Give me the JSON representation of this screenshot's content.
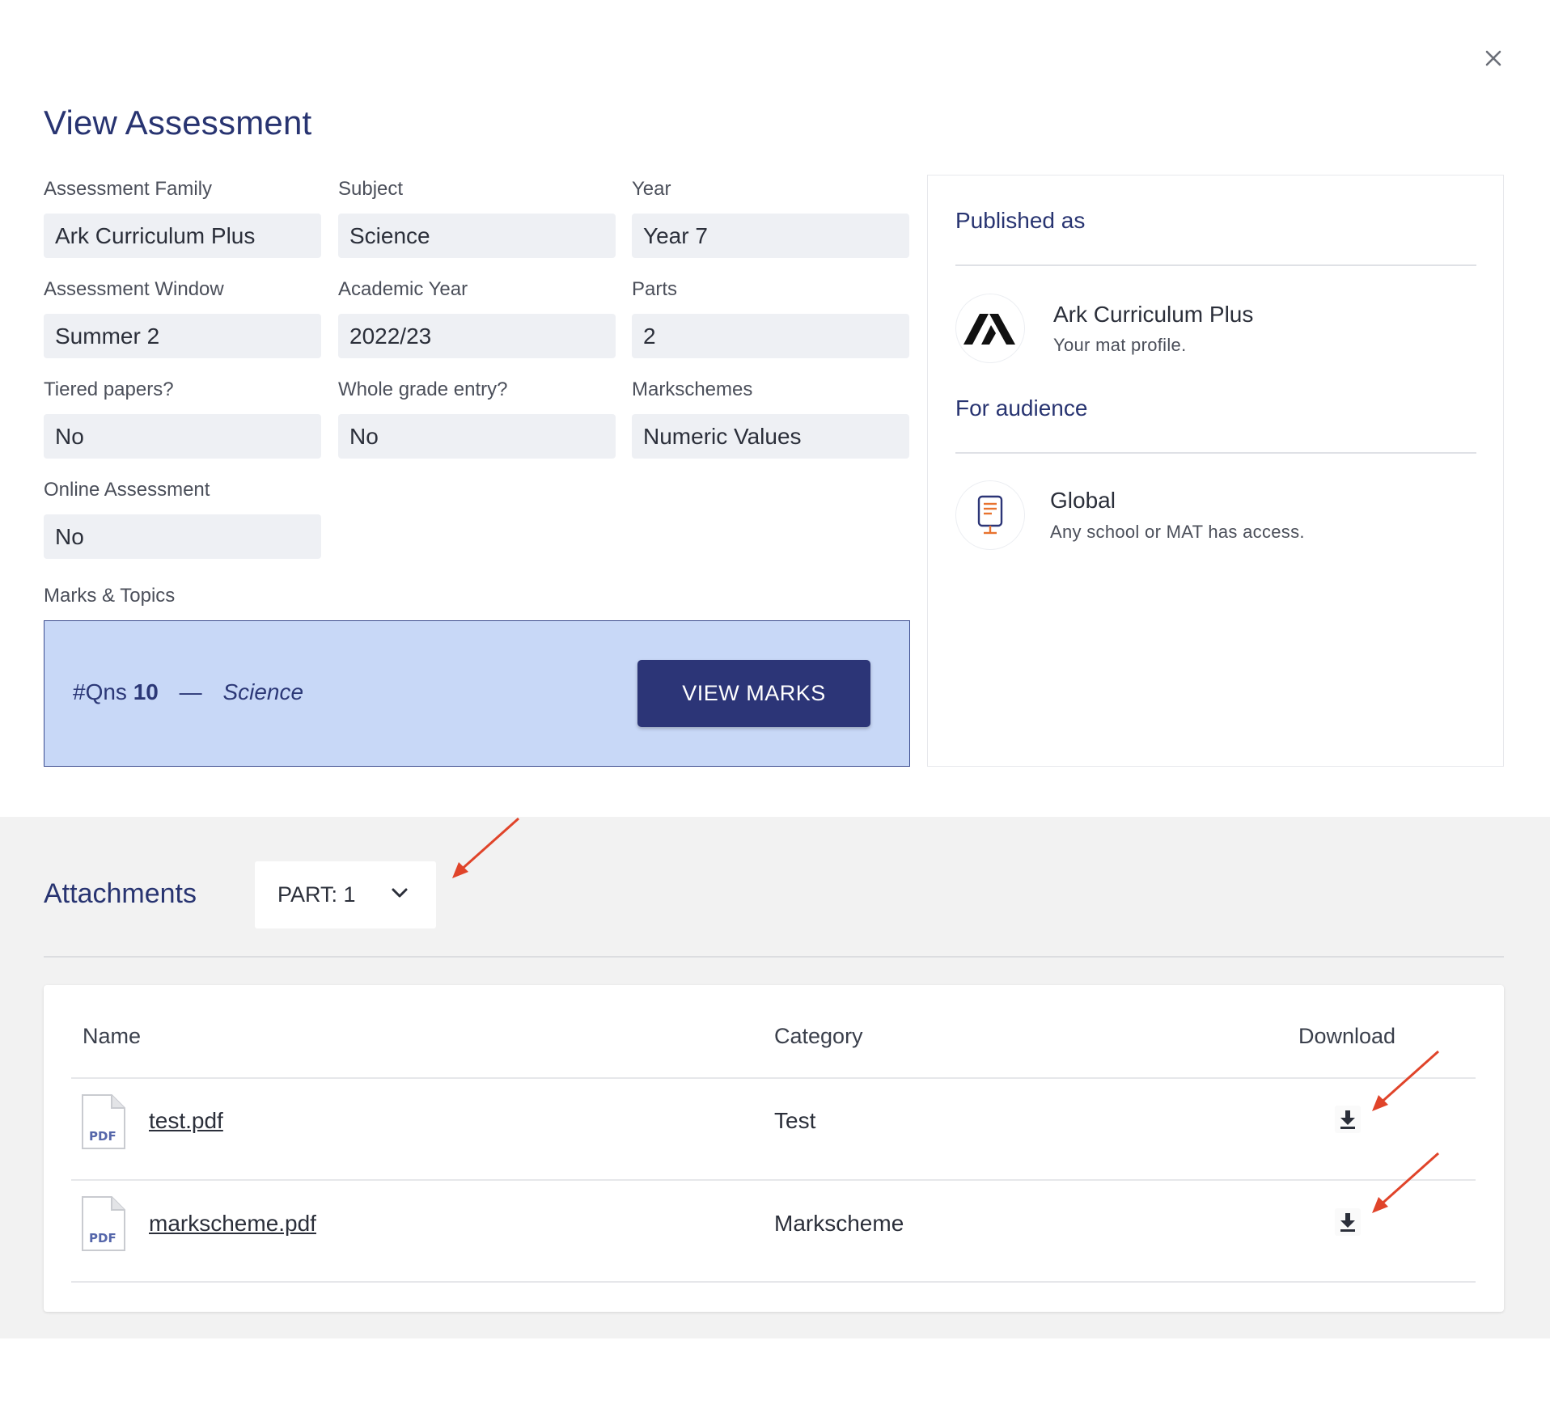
{
  "title": "View Assessment",
  "close_icon": "close-icon",
  "fields": {
    "assessment_family": {
      "label": "Assessment Family",
      "value": "Ark Curriculum Plus"
    },
    "subject": {
      "label": "Subject",
      "value": "Science"
    },
    "year": {
      "label": "Year",
      "value": "Year 7"
    },
    "assessment_window": {
      "label": "Assessment Window",
      "value": "Summer 2"
    },
    "academic_year": {
      "label": "Academic Year",
      "value": "2022/23"
    },
    "parts": {
      "label": "Parts",
      "value": "2"
    },
    "tiered_papers": {
      "label": "Tiered papers?",
      "value": "No"
    },
    "whole_grade_entry": {
      "label": "Whole grade entry?",
      "value": "No"
    },
    "markschemes": {
      "label": "Markschemes",
      "value": "Numeric Values"
    },
    "online_assessment": {
      "label": "Online Assessment",
      "value": "No"
    }
  },
  "marks_topics": {
    "label": "Marks & Topics",
    "qns_prefix": "#Qns",
    "qns_count": "10",
    "separator": "—",
    "subject": "Science",
    "button_label": "VIEW MARKS"
  },
  "publish": {
    "published_as_heading": "Published as",
    "publisher_name": "Ark Curriculum Plus",
    "publisher_sub": "Your mat profile.",
    "audience_heading": "For audience",
    "audience_name": "Global",
    "audience_sub": "Any school or MAT has access."
  },
  "attachments": {
    "title": "Attachments",
    "part_selected": "PART: 1",
    "columns": {
      "name": "Name",
      "category": "Category",
      "download": "Download"
    },
    "rows": [
      {
        "name": "test.pdf",
        "category": "Test",
        "file_badge": "PDF"
      },
      {
        "name": "markscheme.pdf",
        "category": "Markscheme",
        "file_badge": "PDF"
      }
    ]
  },
  "colors": {
    "primary": "#283471",
    "button": "#2c3577",
    "marks_bg": "#c8d8f7",
    "field_bg": "#eef0f4",
    "section_bg": "#f2f2f2",
    "annotation_arrow": "#e0442a",
    "audience_icon": "#e8732f"
  }
}
